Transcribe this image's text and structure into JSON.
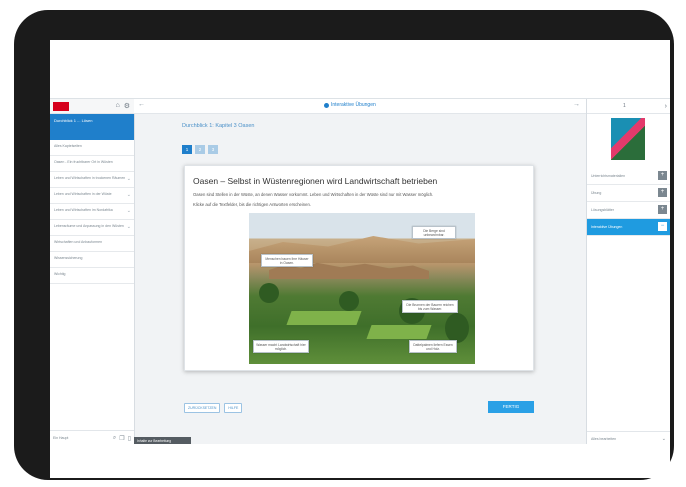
{
  "sidebar": {
    "current": "Durchblick 1 ... Lösen",
    "items": [
      {
        "label": "Alles Kaptelseiten"
      },
      {
        "label": "Oasen - Ein fruchtbarer Ort in Wüsten",
        "chevron": true
      },
      {
        "label": "Leben und Wirtschaften in trockenen Räumen",
        "chevron": true
      },
      {
        "label": "Leben und Wirtschaften in der Wüste",
        "chevron": true
      },
      {
        "label": "Leben und Wirtschaften im Nordafrika",
        "chevron": true
      },
      {
        "label": "Lebensräume und Anpassung in den Wüsten",
        "chevron": true
      },
      {
        "label": "Wirtschaften und Anbauformen",
        "chevron": false
      },
      {
        "label": "Wissenssicherung",
        "chevron": false
      },
      {
        "label": "Wichtig",
        "chevron": false
      }
    ],
    "bottom_label": "Ein Haupt"
  },
  "topbar": {
    "brand": "Interaktive Übungen"
  },
  "main": {
    "breadcrumb": "Durchblick 1: Kapitel 3 Oasen",
    "pages": [
      "1",
      "2",
      "3"
    ],
    "card": {
      "title": "Oasen – Selbst in Wüstenregionen wird Landwirtschaft betrieben",
      "line1": "Oasen sind Stellen in der Wüste, an denen Wasser vorkommt. Leben und Wirtschaften in der Wüste sind nur mit Wasser möglich.",
      "line2": "Klicke auf die Textfelder, bis die richtigen Antworten erscheinen."
    },
    "hotspots": [
      {
        "text": "Menschen bauen ihre Häuser in Oasen."
      },
      {
        "text": "Die Berge sind unbewohnbar."
      },
      {
        "text": "Die Brunnen der Bauern reichen bis zum Wasser."
      },
      {
        "text": "Dattelpalmen liefern Essen und Holz."
      },
      {
        "text": "Wasser macht Landwirtschaft hier möglich."
      }
    ],
    "actions": [
      "ZURÜCKSETZEN",
      "HILFE"
    ],
    "done_label": "FERTIG",
    "status_chip": "Inhalte zur Bearbeitung"
  },
  "rpanel": {
    "page_number": "1",
    "items": [
      {
        "label": "Unterrichtsmaterialien",
        "blue": false
      },
      {
        "label": "Übung",
        "blue": false
      },
      {
        "label": "Lösungsblätter",
        "blue": false
      },
      {
        "label": "Interaktive Übungen",
        "blue": true
      }
    ],
    "bottom_label": "Alles bearbeiten"
  },
  "colors": {
    "accent": "#1f7fcb",
    "brand_red": "#d6001c",
    "done_button": "#2aa0e6"
  }
}
